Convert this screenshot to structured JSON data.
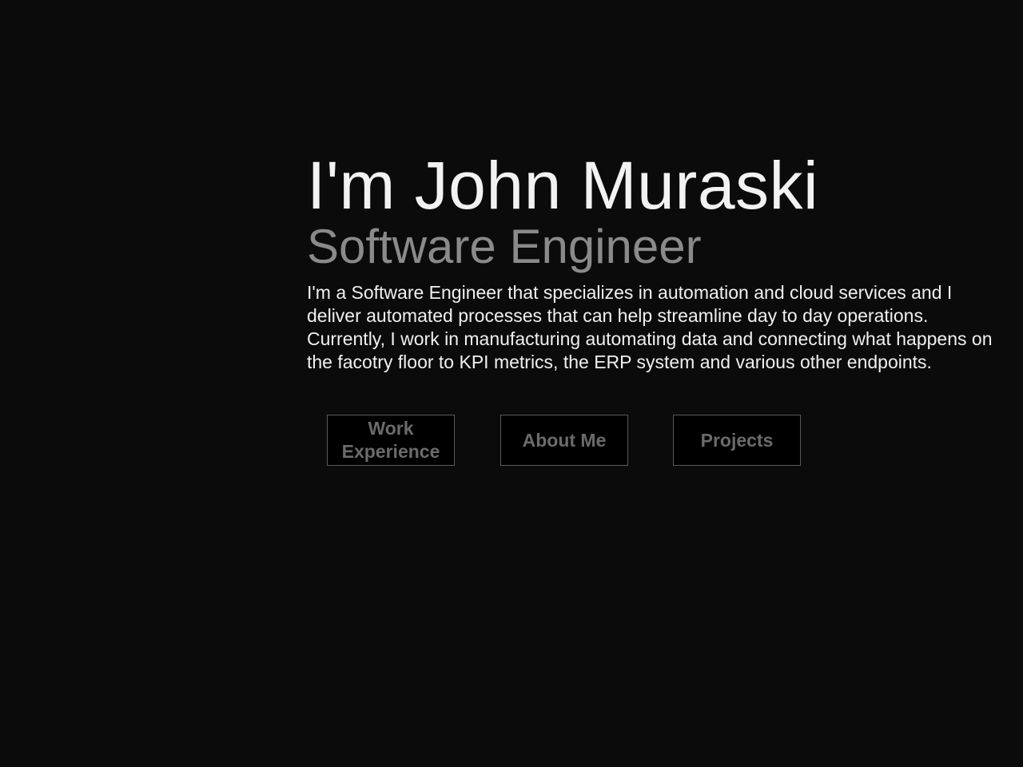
{
  "hero": {
    "name": "I'm John Muraski",
    "role": "Software Engineer",
    "bio": "I'm a Software Engineer that specializes in automation and cloud services and I deliver automated processes that can help streamline day to day operations. Currently, I work in manufacturing automating data and connecting what happens on the facotry floor to KPI metrics, the ERP system and various other endpoints."
  },
  "nav": {
    "work_label": "Work Experience",
    "about_label": "About Me",
    "projects_label": "Projects"
  },
  "colors": {
    "background": "#0b0b0b",
    "name_text": "#f2f2f2",
    "role_text": "#8a8a8a",
    "button_text": "#6b6b6b",
    "button_border": "#5a5a5a"
  }
}
